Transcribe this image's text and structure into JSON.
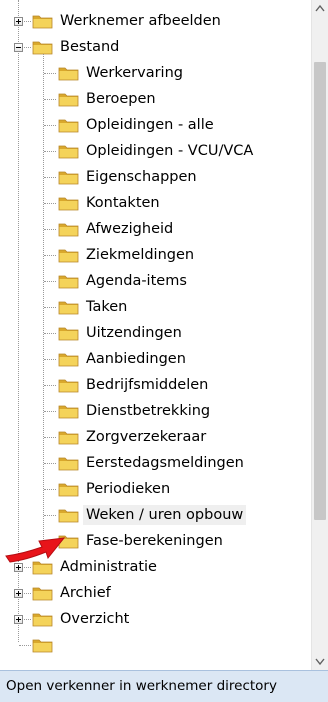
{
  "tree": {
    "top_items": [
      {
        "label": "Werknemer afbeelden",
        "expander": "plus"
      },
      {
        "label": "Bestand",
        "expander": "minus"
      }
    ],
    "children": [
      {
        "label": "Werkervaring"
      },
      {
        "label": "Beroepen"
      },
      {
        "label": "Opleidingen - alle"
      },
      {
        "label": "Opleidingen - VCU/VCA"
      },
      {
        "label": "Eigenschappen"
      },
      {
        "label": "Kontakten"
      },
      {
        "label": "Afwezigheid"
      },
      {
        "label": "Ziekmeldingen"
      },
      {
        "label": "Agenda-items"
      },
      {
        "label": "Taken"
      },
      {
        "label": "Uitzendingen"
      },
      {
        "label": "Aanbiedingen"
      },
      {
        "label": "Bedrijfsmiddelen"
      },
      {
        "label": "Dienstbetrekking"
      },
      {
        "label": "Zorgverzekeraar"
      },
      {
        "label": "Eerstedagsmeldingen"
      },
      {
        "label": "Periodieken"
      },
      {
        "label": "Weken / uren opbouw",
        "selected": true
      },
      {
        "label": "Fase-berekeningen"
      }
    ],
    "bottom_items": [
      {
        "label": "Administratie",
        "expander": "plus"
      },
      {
        "label": "Archief",
        "expander": "plus"
      },
      {
        "label": "Overzicht",
        "expander": "plus"
      }
    ]
  },
  "status_bar": {
    "text": "Open verkenner in werknemer directory"
  },
  "colors": {
    "folder": "#f4d35a",
    "folder_dark": "#d9a82c",
    "pointer": "#e8141a",
    "status_bg": "#dbe7f4"
  },
  "icons": {
    "folder": "folder-icon",
    "expand": "expand-plus-icon",
    "collapse": "collapse-minus-icon",
    "pointer": "red-arrow-icon"
  }
}
